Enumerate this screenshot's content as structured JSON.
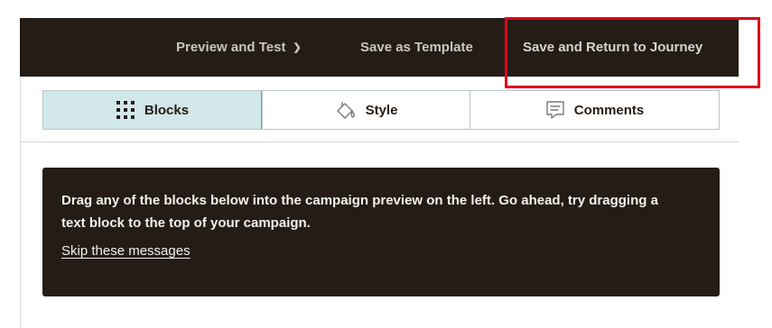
{
  "header": {
    "preview_label": "Preview and Test",
    "save_template_label": "Save as Template",
    "save_return_label": "Save and Return to Journey"
  },
  "tabs": [
    {
      "label": "Blocks",
      "icon": "grid-icon",
      "active": true
    },
    {
      "label": "Style",
      "icon": "paint-bucket-icon",
      "active": false
    },
    {
      "label": "Comments",
      "icon": "comment-icon",
      "active": false
    }
  ],
  "message": {
    "text": "Drag any of the blocks below into the campaign preview on the left. Go ahead, try dragging a text block to the top of your campaign.",
    "skip_label": "Skip these messages"
  },
  "colors": {
    "header_bg": "#241c15",
    "active_tab_bg": "#d2e7ea",
    "highlight": "#e0001b"
  }
}
